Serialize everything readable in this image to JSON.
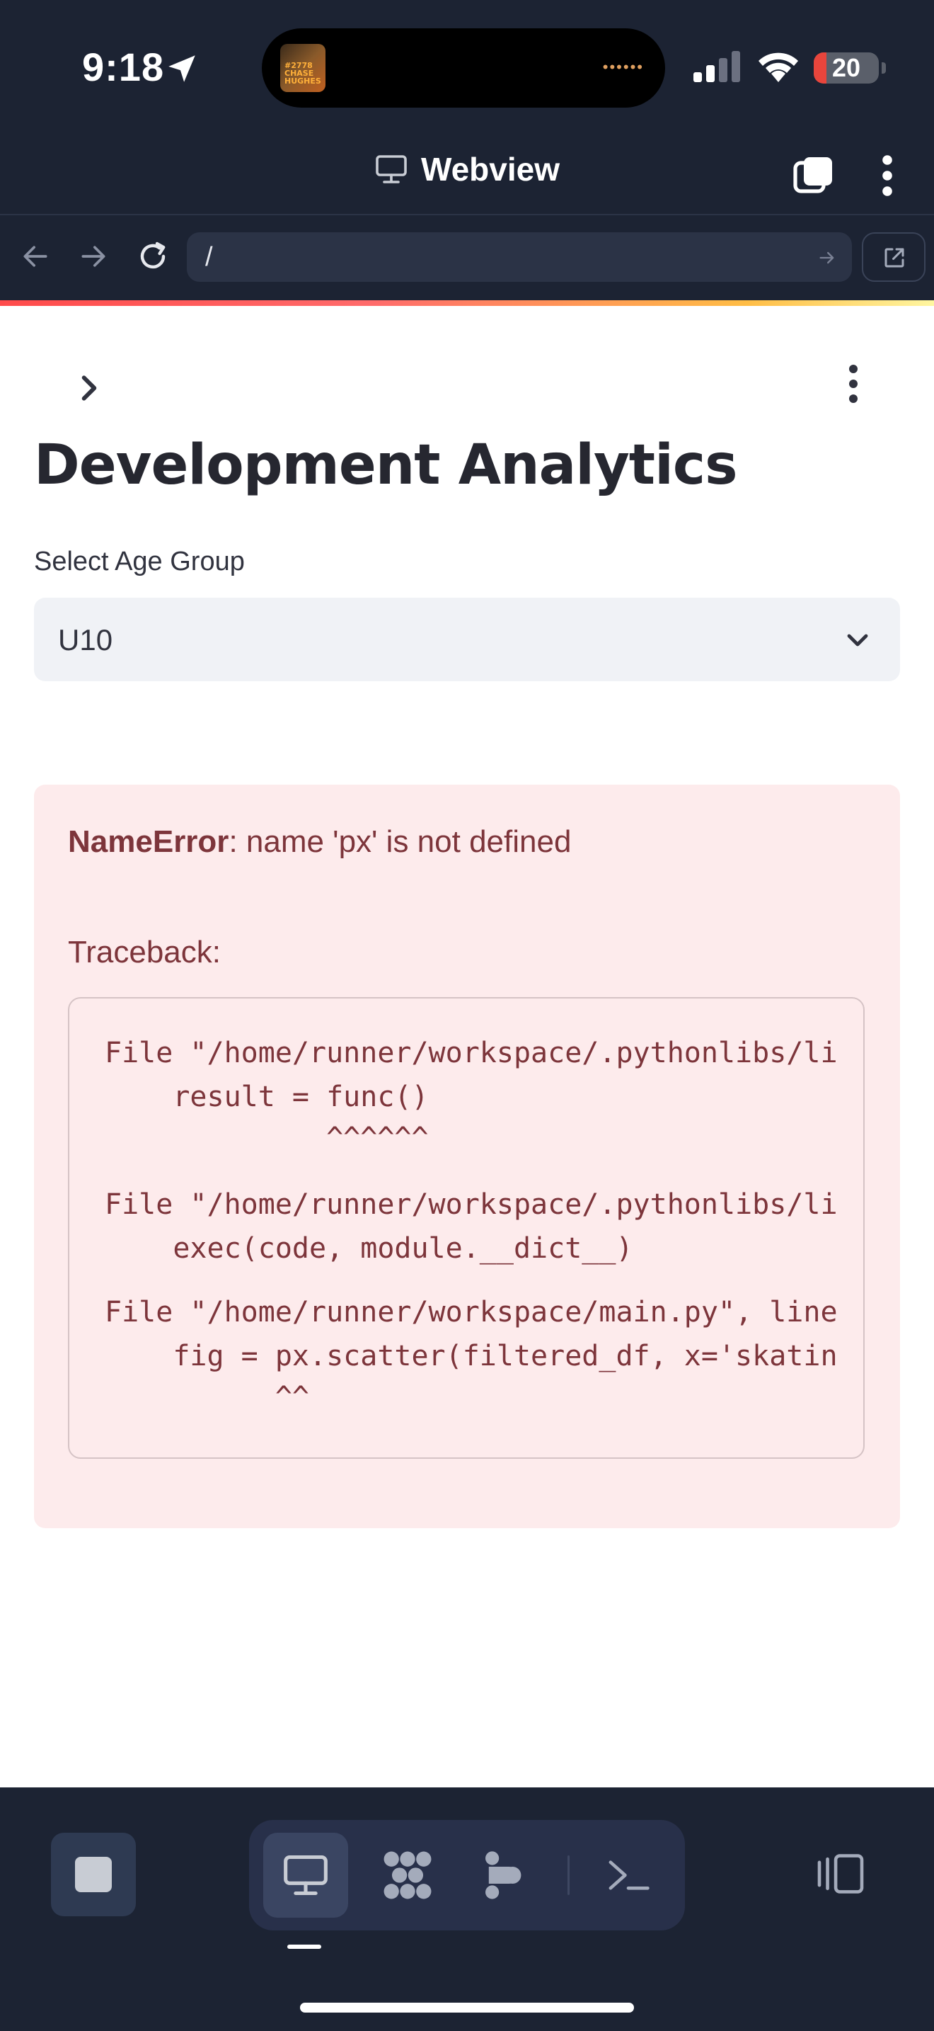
{
  "status_bar": {
    "time": "9:18",
    "battery_level": "20",
    "battery_fraction": 0.2,
    "island_thumb_text": "#2778 CHASE HUGHES",
    "icons": [
      "location-arrow-icon",
      "cellular-signal-icon",
      "wifi-icon",
      "battery-icon"
    ]
  },
  "header": {
    "title": "Webview",
    "icons": [
      "monitor-icon",
      "tabs-icon",
      "more-vertical-icon"
    ]
  },
  "url_bar": {
    "url": "/",
    "icons": [
      "back-arrow-icon",
      "forward-arrow-icon",
      "reload-icon",
      "go-arrow-icon",
      "open-external-icon"
    ]
  },
  "app": {
    "title": "Development Analytics",
    "select": {
      "label": "Select Age Group",
      "value": "U10"
    },
    "error": {
      "type": "NameError",
      "message": ": name 'px' is not defined",
      "traceback_label": "Traceback:",
      "lines": [
        "File \"/home/runner/workspace/.pythonlibs/li",
        "    result = func()",
        "             ^^^^^^",
        "File \"/home/runner/workspace/.pythonlibs/li",
        "    exec(code, module.__dict__)",
        "File \"/home/runner/workspace/main.py\", line",
        "    fig = px.scatter(filtered_df, x='skatin",
        "          ^^"
      ]
    }
  },
  "bottom_bar": {
    "tools": [
      "webview-tool",
      "workflows-tool",
      "deploy-tool",
      "shell-tool"
    ],
    "active_tool": "webview-tool"
  },
  "colors": {
    "chrome_bg": "#1c2333",
    "error_bg": "#fdebec",
    "error_text": "#7d353b",
    "select_bg": "#f0f2f6",
    "accent_gradient": [
      "#ff4b4b",
      "#ffbd45"
    ]
  }
}
